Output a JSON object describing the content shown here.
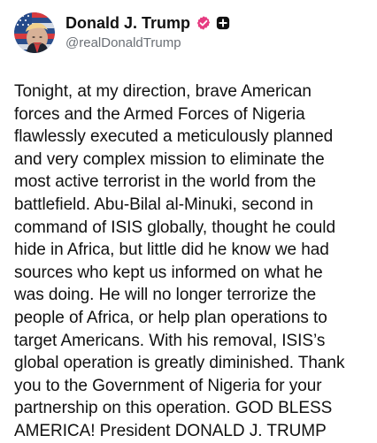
{
  "post": {
    "author": {
      "display_name": "Donald J. Trump",
      "handle": "@realDonaldTrump",
      "avatar_icon": "profile-avatar",
      "verified_icon": "verified-badge-icon",
      "affiliate_icon": "plus-square-icon",
      "verified_color": "#e63c81",
      "affiliate_color": "#111111"
    },
    "text": "Tonight, at my direction, brave American\nforces and the Armed Forces of Nigeria\nflawlessly executed a meticulously planned\nand very complex mission to eliminate the\nmost active terrorist in the world from the\nbattlefield. Abu-Bilal al-Minuki, second in\ncommand of ISIS globally, thought he could\nhide in Africa, but little did he know we had\nsources who kept us informed on what he\nwas doing. He will no longer terrorize the\npeople of Africa, or help plan operations to\ntarget Americans. With his removal, ISIS’s\nglobal operation is greatly diminished. Thank\nyou to the Government of Nigeria for your\npartnership on this operation. GOD BLESS\nAMERICA! President DONALD J. TRUMP"
  },
  "colors": {
    "background": "#ffffff",
    "text": "#111111",
    "muted": "#6a6f75"
  }
}
